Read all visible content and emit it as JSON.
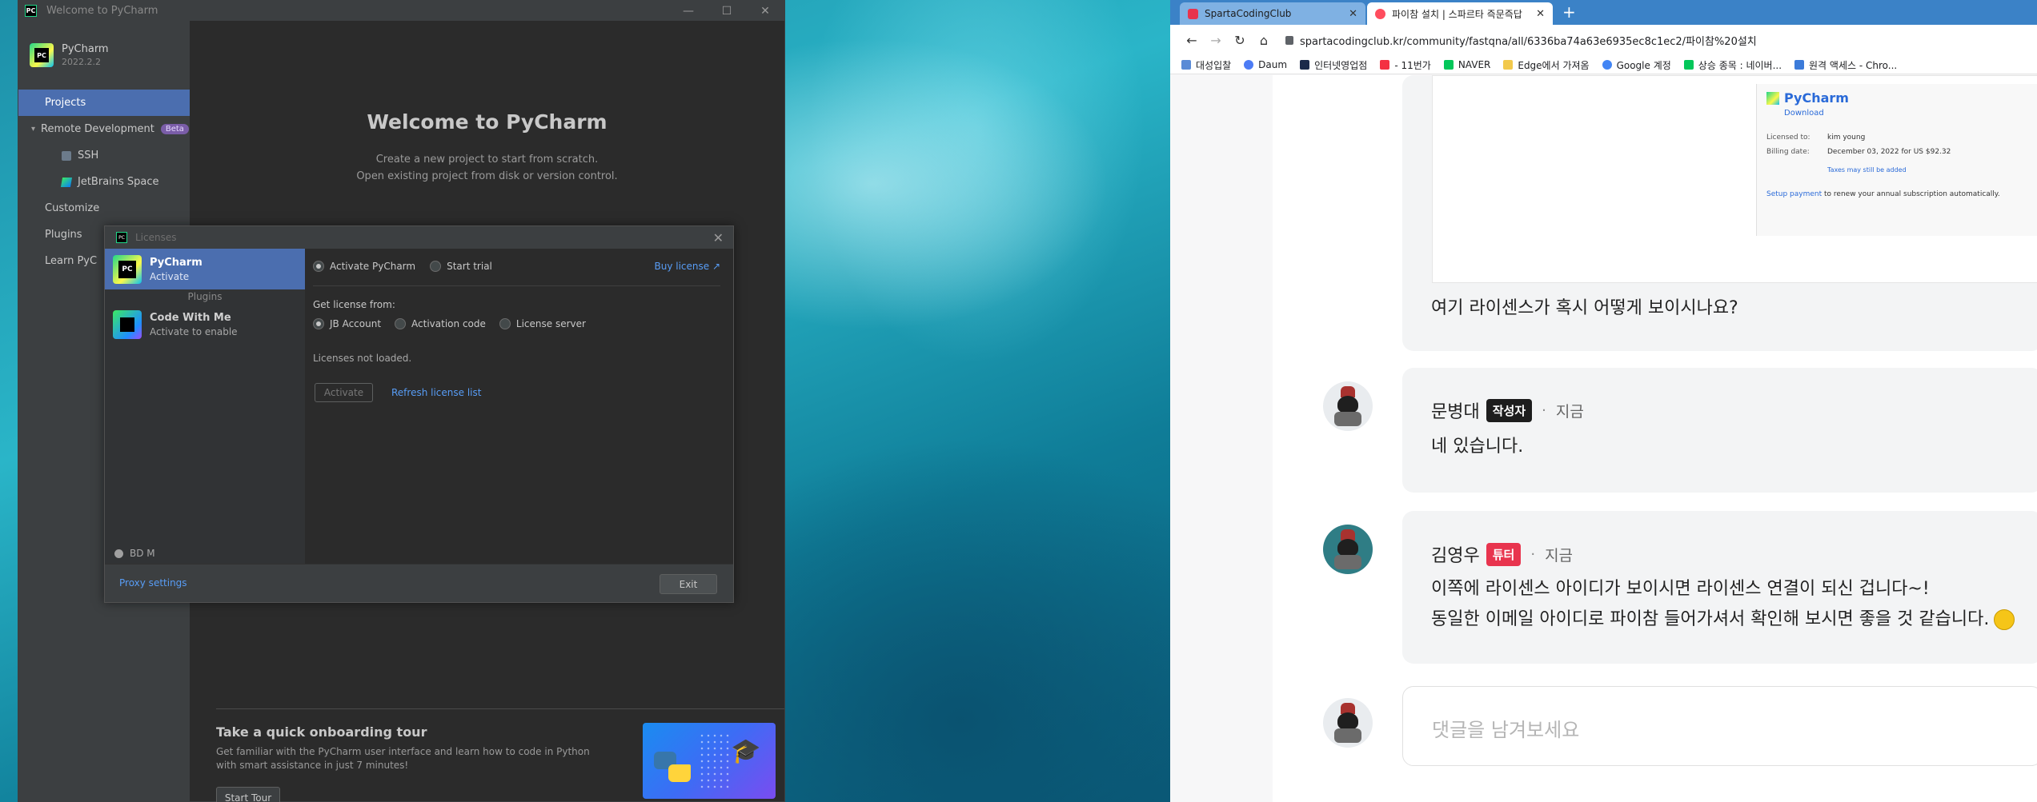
{
  "pycharm": {
    "window_title": "Welcome to PyCharm",
    "brand_name": "PyCharm",
    "brand_version": "2022.2.2",
    "nav": {
      "projects": "Projects",
      "remote_development": "Remote Development",
      "beta": "Beta",
      "ssh": "SSH",
      "jetbrains_space": "JetBrains Space",
      "customize": "Customize",
      "plugins": "Plugins",
      "learn": "Learn PyC"
    },
    "welcome_title": "Welcome to PyCharm",
    "welcome_line1": "Create a new project to start from scratch.",
    "welcome_line2": "Open existing project from disk or version control.",
    "tour_title": "Take a quick onboarding tour",
    "tour_desc": "Get familiar with the PyCharm user interface and learn how to code in Python with smart assistance in just 7 minutes!",
    "tour_button": "Start Tour"
  },
  "licenses": {
    "title": "Licenses",
    "products": [
      {
        "name": "PyCharm",
        "state": "Activate"
      },
      {
        "name": "Code With Me",
        "state": "Activate to enable"
      }
    ],
    "plugins_header": "Plugins",
    "user": "BD M",
    "activate_pycharm": "Activate PyCharm",
    "start_trial": "Start trial",
    "buy_license": "Buy license ↗",
    "get_license_from": "Get license from:",
    "jb_account": "JB Account",
    "activation_code": "Activation code",
    "license_server": "License server",
    "not_loaded": "Licenses not loaded.",
    "activate_button": "Activate",
    "refresh_link": "Refresh license list",
    "proxy_settings": "Proxy settings",
    "exit_button": "Exit"
  },
  "browser": {
    "tabs": [
      {
        "label": "SpartaCodingClub",
        "active": false
      },
      {
        "label": "파이참 설치 | 스파르타 즉문즉답",
        "active": true
      }
    ],
    "address": "spartacodingclub.kr/community/fastqna/all/6336ba74a63e6935ec8c1ec2/파이참%20설치",
    "bookmarks": [
      "대성입찰",
      "Daum",
      "인터넷영업점",
      "- 11번가",
      "NAVER",
      "Edge에서 가져옴",
      "Google 계정",
      "상승 종목 : 네이버...",
      "원격 액세스 - Chro..."
    ]
  },
  "screenshot_card": {
    "brand": "PyCharm",
    "download": "Download",
    "licensed_to_label": "Licensed to:",
    "licensed_to_value": "kim young",
    "billing_label": "Billing date:",
    "billing_value": "December 03, 2022 for US $92.32",
    "taxes": "Taxes may still be added",
    "setup_link": "Setup payment",
    "setup_rest": " to renew your annual subscription automatically."
  },
  "comments": {
    "question": "여기 라이센스가 혹시 어떻게 보이시나요?",
    "c1": {
      "author": "문병대",
      "badge": "작성자",
      "time": "지금",
      "text": "네 있습니다."
    },
    "c2": {
      "author": "김영우",
      "badge": "튜터",
      "time": "지금",
      "line1": "이쪽에 라이센스 아이디가 보이시면 라이센스 연결이 되신 겁니다~!",
      "line2": "동일한 이메일 아이디로 파이참 들어가셔서 확인해 보시면 좋을 것 같습니다."
    },
    "reply_placeholder": "댓글을 남겨보세요"
  }
}
